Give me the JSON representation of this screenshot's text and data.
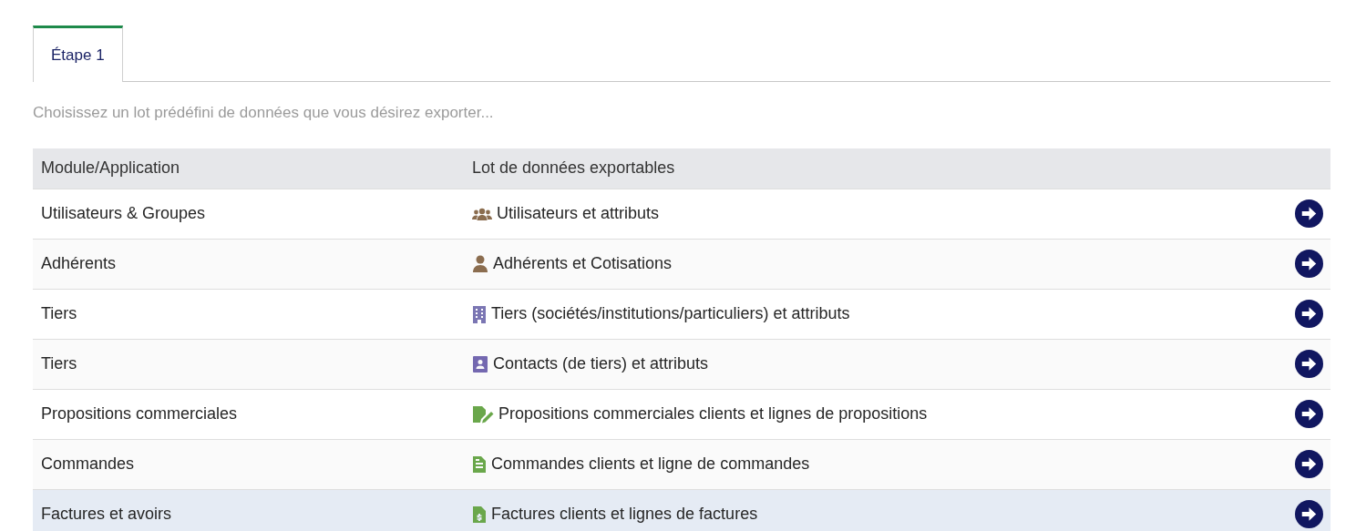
{
  "tabs": [
    {
      "label": "Étape 1",
      "selected": true
    }
  ],
  "hint": "Choisissez un lot prédéfini de données que vous désirez exporter...",
  "table": {
    "columns": [
      "Module/Application",
      "Lot de données exportables"
    ],
    "rows": [
      {
        "module": "Utilisateurs & Groupes",
        "dataset": "Utilisateurs et attributs",
        "kind": "users",
        "highlighted": false
      },
      {
        "module": "Adhérents",
        "dataset": "Adhérents et Cotisations",
        "kind": "member",
        "highlighted": false
      },
      {
        "module": "Tiers",
        "dataset": "Tiers (sociétés/institutions/particuliers) et attributs",
        "kind": "company",
        "highlighted": false
      },
      {
        "module": "Tiers",
        "dataset": "Contacts (de tiers) et attributs",
        "kind": "contact",
        "highlighted": false
      },
      {
        "module": "Propositions commerciales",
        "dataset": "Propositions commerciales clients et lignes de propositions",
        "kind": "proposal",
        "highlighted": false
      },
      {
        "module": "Commandes",
        "dataset": "Commandes clients et ligne de commandes",
        "kind": "order",
        "highlighted": false
      },
      {
        "module": "Factures et avoirs",
        "dataset": "Factures clients et lignes de factures",
        "kind": "invoice",
        "highlighted": true
      }
    ]
  }
}
